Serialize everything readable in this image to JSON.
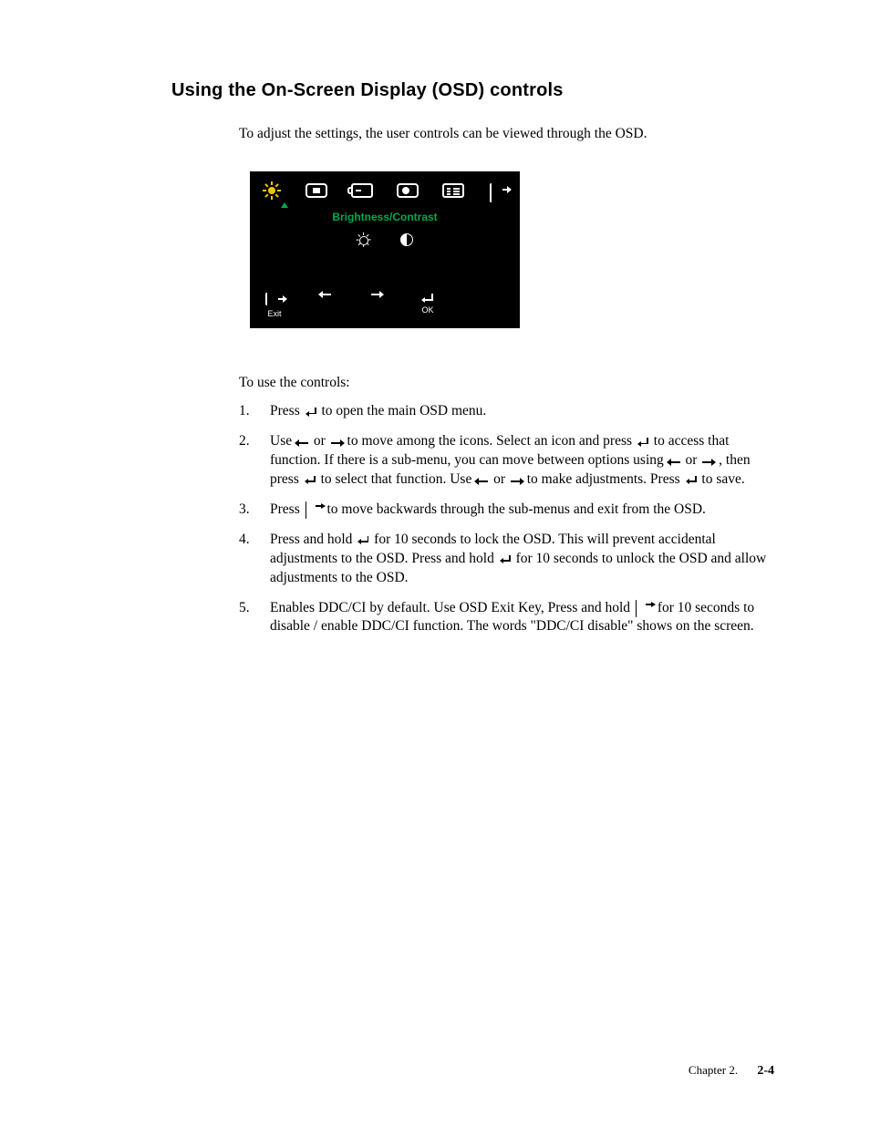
{
  "heading": "Using the On-Screen Display (OSD) controls",
  "intro": "To adjust the settings,  the user controls can be viewed through the OSD.",
  "osd": {
    "title": "Brightness/Contrast",
    "bottom": {
      "exit_label": "Exit",
      "ok_label": "OK"
    }
  },
  "instructions_intro": "To use the controls:",
  "steps": {
    "s1a": "Press ",
    "s1b": " to open the main OSD menu.",
    "s2a": "Use ",
    "s2b": " or ",
    "s2c": " to move among the icons. Select an icon and press ",
    "s2d": " to access that function. If there is a sub-menu, you can move between options using ",
    "s2e": " or ",
    "s2f": ", then press ",
    "s2g": " to select that function. Use ",
    "s2h": " or ",
    "s2i": " to make adjustments. Press ",
    "s2j": " to save.",
    "s3a": "Press ",
    "s3b": " to move backwards through the sub-menus and exit from the OSD.",
    "s4a": "Press and hold  ",
    "s4b": "  for 10 seconds to lock the OSD. This will prevent accidental adjustments to the OSD. Press and hold ",
    "s4c": "  for 10 seconds to unlock the OSD and allow adjustments to the OSD.",
    "s5a": "Enables DDC/CI by default. Use OSD Exit Key,  Press and hold ",
    "s5b": " for 10 seconds to disable / enable DDC/CI function. The words \"DDC/CI disable\" shows on the screen."
  },
  "footer": {
    "chapter": "Chapter 2.",
    "page": "2-4"
  }
}
